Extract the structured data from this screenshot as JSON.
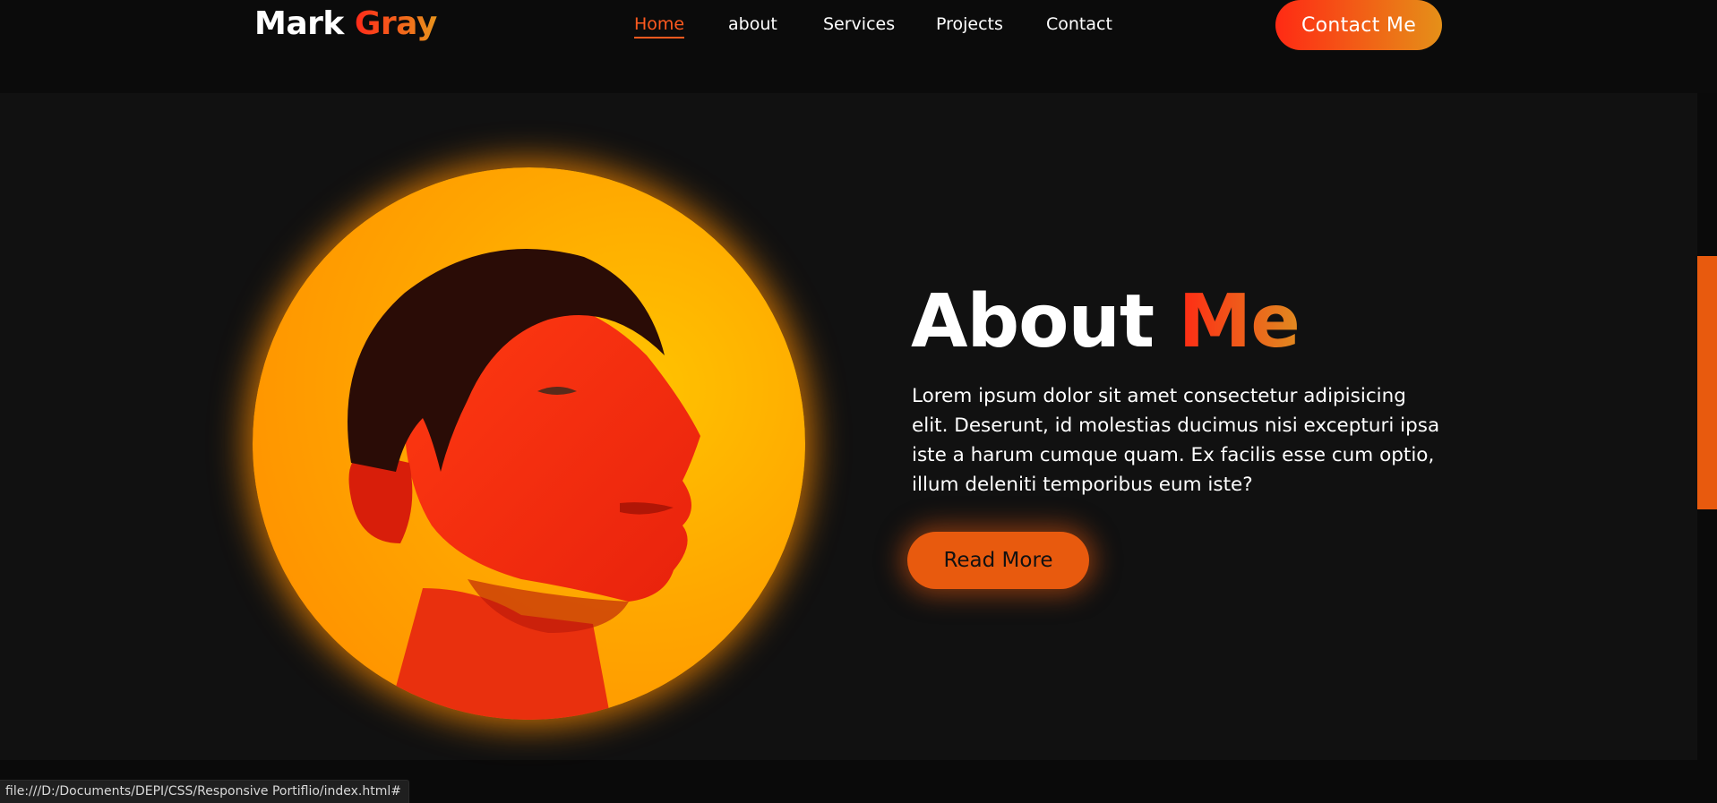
{
  "header": {
    "logo_main": "Mark",
    "logo_accent": "Gray",
    "nav": [
      {
        "label": "Home",
        "active": true
      },
      {
        "label": "about",
        "active": false
      },
      {
        "label": "Services",
        "active": false
      },
      {
        "label": "Projects",
        "active": false
      },
      {
        "label": "Contact",
        "active": false
      }
    ],
    "contact_button": "Contact Me"
  },
  "about": {
    "title_main": "About",
    "title_accent": "Me",
    "text": "Lorem ipsum dolor sit amet consectetur adipisicing elit. Deserunt, id molestias ducimus nisi excepturi ipsa iste a harum cumque quam. Ex facilis esse cum optio, illum deleniti temporibus eum iste?",
    "button": "Read More",
    "photo_icon": "portrait-photo"
  },
  "status_bar": {
    "url": "file:///D:/Documents/DEPI/CSS/Responsive Portiflio/index.html#"
  },
  "colors": {
    "accent_red": "#ff2a14",
    "accent_orange": "#e8941c",
    "button_orange": "#e85a0e",
    "background": "#111111"
  }
}
